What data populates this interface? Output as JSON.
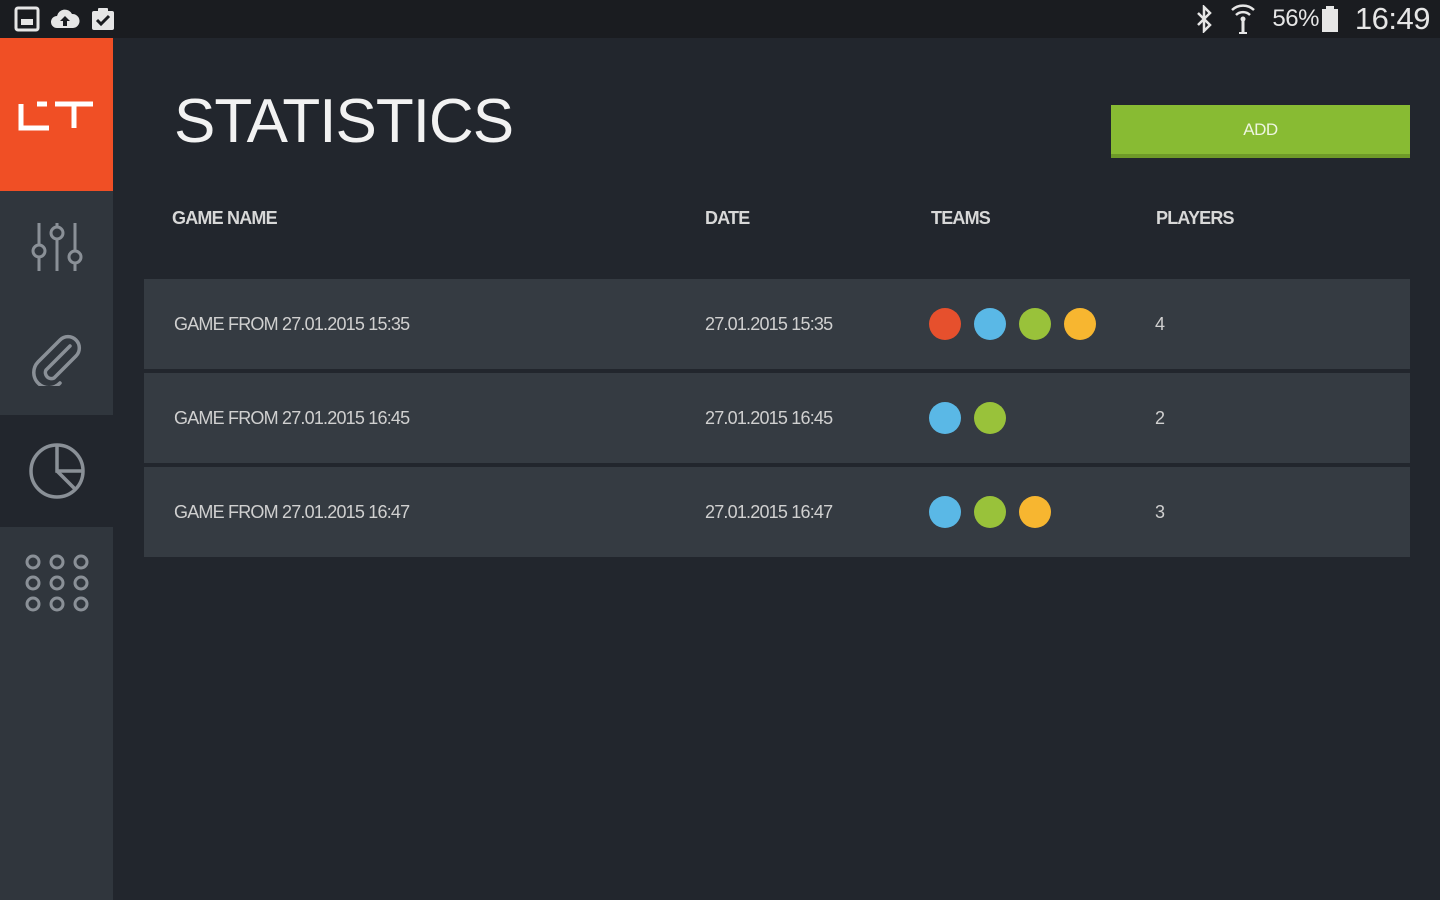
{
  "status_bar": {
    "battery": "56%",
    "time": "16:49"
  },
  "sidebar": {
    "logo_text": "LT",
    "items": [
      {
        "icon": "sliders-icon",
        "active": false
      },
      {
        "icon": "paperclip-icon",
        "active": false
      },
      {
        "icon": "pie-chart-icon",
        "active": true
      },
      {
        "icon": "grid-icon",
        "active": false
      }
    ]
  },
  "header": {
    "title": "STATISTICS",
    "add_label": "ADD"
  },
  "table": {
    "columns": {
      "name": "GAME NAME",
      "date": "DATE",
      "teams": "TEAMS",
      "players": "PLAYERS"
    },
    "rows": [
      {
        "name": "GAME FROM 27.01.2015 15:35",
        "date": "27.01.2015 15:35",
        "teams": [
          "red",
          "blue",
          "green",
          "yellow"
        ],
        "players": "4"
      },
      {
        "name": "GAME FROM 27.01.2015 16:45",
        "date": "27.01.2015 16:45",
        "teams": [
          "blue",
          "green"
        ],
        "players": "2"
      },
      {
        "name": "GAME FROM 27.01.2015 16:47",
        "date": "27.01.2015 16:47",
        "teams": [
          "blue",
          "green",
          "yellow"
        ],
        "players": "3"
      }
    ]
  },
  "colors": {
    "accent": "#f04f25",
    "add_button": "#88bb33",
    "team_red": "#e6502d",
    "team_blue": "#5ab8e6",
    "team_green": "#99c23a",
    "team_yellow": "#f7b630"
  }
}
